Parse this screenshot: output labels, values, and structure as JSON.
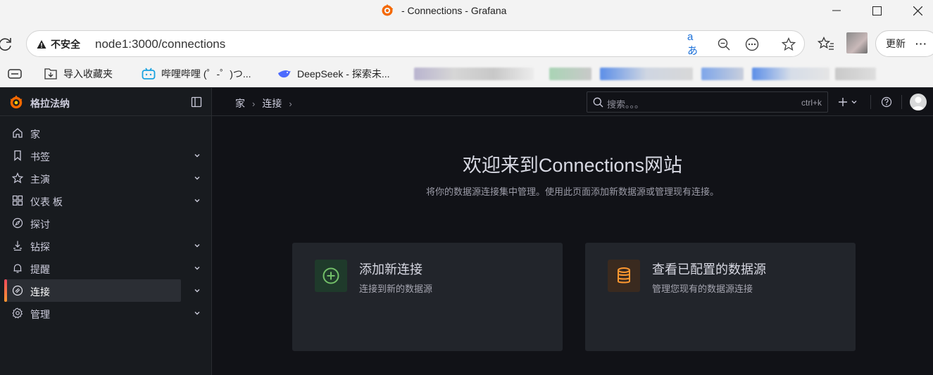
{
  "browser": {
    "window_title": "- Connections - Grafana",
    "insecure_label": "不安全",
    "url": "node1:3000/connections",
    "translate_label": "aあ",
    "update_label": "更新",
    "more_label": "···"
  },
  "bookmarks": [
    {
      "label": "导入收藏夹"
    },
    {
      "label": "哔哩哔哩 (゜-゜)つ..."
    },
    {
      "label": "DeepSeek - 探索未..."
    }
  ],
  "grafana": {
    "brand": "格拉法纳",
    "breadcrumb": [
      "家",
      "连接"
    ],
    "search_placeholder": "搜索。。。",
    "search_shortcut": "ctrl+k",
    "nav": [
      {
        "label": "家",
        "icon": "home-icon",
        "chevron": false,
        "active": false
      },
      {
        "label": "书签",
        "icon": "bookmark-icon",
        "chevron": true,
        "active": false
      },
      {
        "label": "主演",
        "icon": "star-icon",
        "chevron": true,
        "active": false
      },
      {
        "label": "仪表 板",
        "icon": "dashboard-grid-icon",
        "chevron": true,
        "active": false
      },
      {
        "label": "探讨",
        "icon": "compass-icon",
        "chevron": false,
        "active": false
      },
      {
        "label": "钻探",
        "icon": "drilldown-icon",
        "chevron": true,
        "active": false
      },
      {
        "label": "提醒",
        "icon": "bell-icon",
        "chevron": true,
        "active": false
      },
      {
        "label": "连接",
        "icon": "link-icon",
        "chevron": true,
        "active": true
      },
      {
        "label": "管理",
        "icon": "cog-icon",
        "chevron": true,
        "active": false
      }
    ],
    "page": {
      "title": "欢迎来到Connections网站",
      "subtitle": "将你的数据源连接集中管理。使用此页面添加新数据源或管理现有连接。",
      "cards": [
        {
          "title": "添加新连接",
          "description": "连接到新的数据源",
          "icon": "plus-circle-icon",
          "accent": "#73bf69"
        },
        {
          "title": "查看已配置的数据源",
          "description": "管理您现有的数据源连接",
          "icon": "database-icon",
          "accent": "#ff9830"
        }
      ]
    }
  },
  "colors": {
    "grafana_bg": "#111217",
    "sidebar_bg": "#181b1f",
    "card_bg": "#22252b",
    "text": "#ccccdc"
  }
}
